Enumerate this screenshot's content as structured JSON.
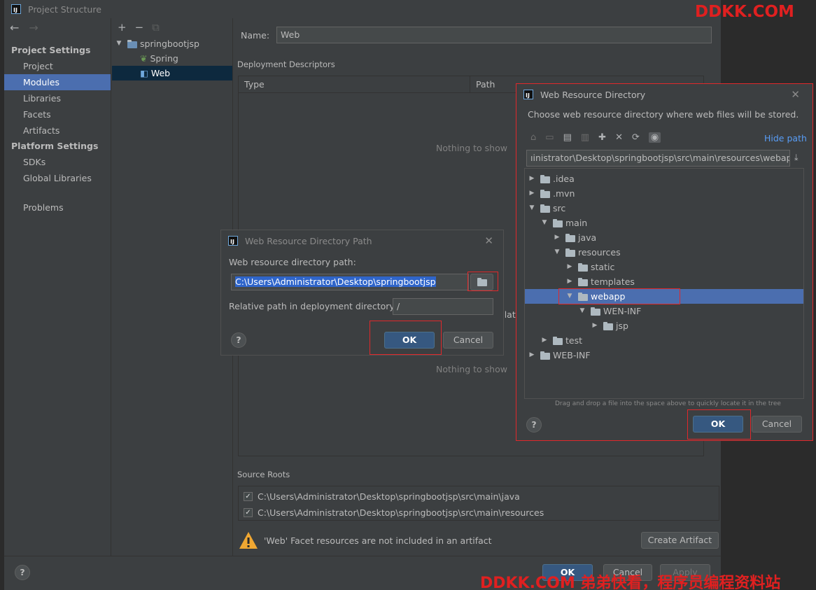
{
  "window": {
    "title": "Project Structure"
  },
  "sidebar": {
    "project_settings_heading": "Project Settings",
    "project_items": [
      {
        "label": "Project"
      },
      {
        "label": "Modules"
      },
      {
        "label": "Libraries"
      },
      {
        "label": "Facets"
      },
      {
        "label": "Artifacts"
      }
    ],
    "platform_settings_heading": "Platform Settings",
    "platform_items": [
      {
        "label": "SDKs"
      },
      {
        "label": "Global Libraries"
      }
    ],
    "problems_label": "Problems"
  },
  "module_tree": {
    "root": "springbootjsp",
    "children": [
      {
        "label": "Spring"
      },
      {
        "label": "Web"
      }
    ]
  },
  "content": {
    "name_label": "Name:",
    "name_value": "Web",
    "deployment_descriptors_label": "Deployment Descriptors",
    "table_headers": {
      "type": "Type",
      "path": "Path"
    },
    "empty_text": "Nothing to show",
    "partial_header": "elat",
    "source_roots_label": "Source Roots",
    "source_roots": [
      {
        "path": "C:\\Users\\Administrator\\Desktop\\springbootjsp\\src\\main\\java",
        "checked": "✓"
      },
      {
        "path": "C:\\Users\\Administrator\\Desktop\\springbootjsp\\src\\main\\resources",
        "checked": "✓"
      }
    ],
    "warning_text": "'Web' Facet resources are not included in an artifact",
    "create_artifact_label": "Create Artifact"
  },
  "footer": {
    "ok": "OK",
    "cancel": "Cancel",
    "apply": "Apply"
  },
  "path_dialog": {
    "title": "Web Resource Directory Path",
    "path_label": "Web resource directory path:",
    "path_value": "C:\\Users\\Administrator\\Desktop\\springbootjsp",
    "relative_label": "Relative path in deployment directory:",
    "relative_value": "/",
    "ok": "OK",
    "cancel": "Cancel"
  },
  "browse_dialog": {
    "title": "Web Resource Directory",
    "description": "Choose web resource directory where web files will be stored.",
    "hide_path": "Hide path",
    "path_value": "ıinistrator\\Desktop\\springbootjsp\\src\\main\\resources\\webapp",
    "tree": [
      {
        "label": ".idea",
        "depth": 0,
        "expanded": false
      },
      {
        "label": ".mvn",
        "depth": 0,
        "expanded": false
      },
      {
        "label": "src",
        "depth": 0,
        "expanded": true
      },
      {
        "label": "main",
        "depth": 1,
        "expanded": true
      },
      {
        "label": "java",
        "depth": 2,
        "expanded": false
      },
      {
        "label": "resources",
        "depth": 2,
        "expanded": true
      },
      {
        "label": "static",
        "depth": 3,
        "expanded": false
      },
      {
        "label": "templates",
        "depth": 3,
        "expanded": false
      },
      {
        "label": "webapp",
        "depth": 3,
        "expanded": true,
        "selected": true
      },
      {
        "label": "WEN-INF",
        "depth": 4,
        "expanded": true
      },
      {
        "label": "jsp",
        "depth": 5,
        "expanded": false
      },
      {
        "label": "test",
        "depth": 1,
        "expanded": false
      },
      {
        "label": "WEB-INF",
        "depth": 0,
        "expanded": false
      }
    ],
    "drag_hint": "Drag and drop a file into the space above to quickly locate it in the tree",
    "ok": "OK",
    "cancel": "Cancel"
  },
  "watermarks": {
    "top": "DDKK.COM",
    "bottom": "DDKK.COM 弟弟快看，程序员编程资料站"
  },
  "colors": {
    "selection": "#4b6eaf",
    "primary_button": "#365880",
    "highlight_box": "#e0282b",
    "watermark": "#e02020"
  }
}
